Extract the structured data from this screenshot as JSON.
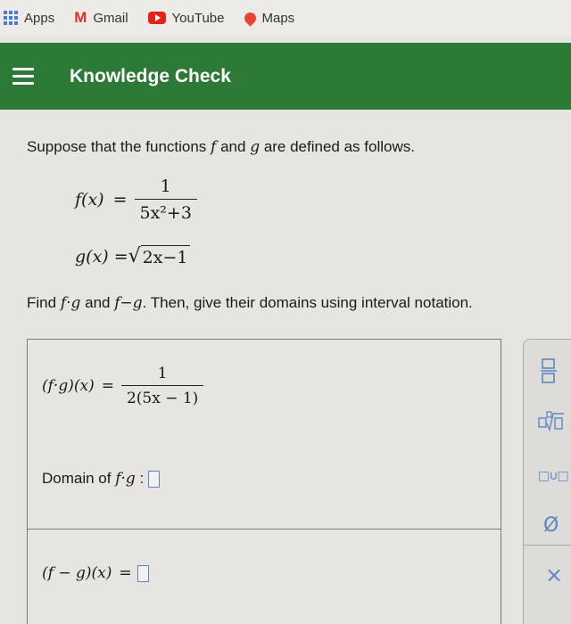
{
  "bookmarks": [
    {
      "label": "Apps"
    },
    {
      "label": "Gmail"
    },
    {
      "label": "YouTube"
    },
    {
      "label": "Maps"
    }
  ],
  "header": {
    "title": "Knowledge Check"
  },
  "problem": {
    "intro_before": "Suppose that the functions",
    "intro_and": "and",
    "intro_after": "are defined as follows.",
    "f": "f",
    "g": "g",
    "f_lhs": "f(x)",
    "f_num": "1",
    "f_den": "5x²+3",
    "g_lhs": "g(x)",
    "g_radicand": "2x−1",
    "equals": "="
  },
  "instructions": {
    "find": "Find",
    "product": "f·g",
    "and": "and",
    "difference": "f−g",
    "rest": ". Then, give their domains using interval notation."
  },
  "answers": {
    "product_lhs": "(f·g)(x)",
    "product_num": "1",
    "product_den": "2(5x − 1)",
    "domain_label": "Domain of",
    "domain_expr": "f·g",
    "colon": ":",
    "difference_lhs": "(f − g)(x)",
    "equals": "="
  },
  "toolbar": {
    "fraction_icon": "fraction-icon",
    "nth_root_icon": "nth-root-icon",
    "union_icon": "union-icon",
    "union_label": "□∪□",
    "empty_set_label": "Ø",
    "clear_label": "×"
  },
  "colors": {
    "header": "#2d7a36",
    "accent": "#5a86c4"
  }
}
